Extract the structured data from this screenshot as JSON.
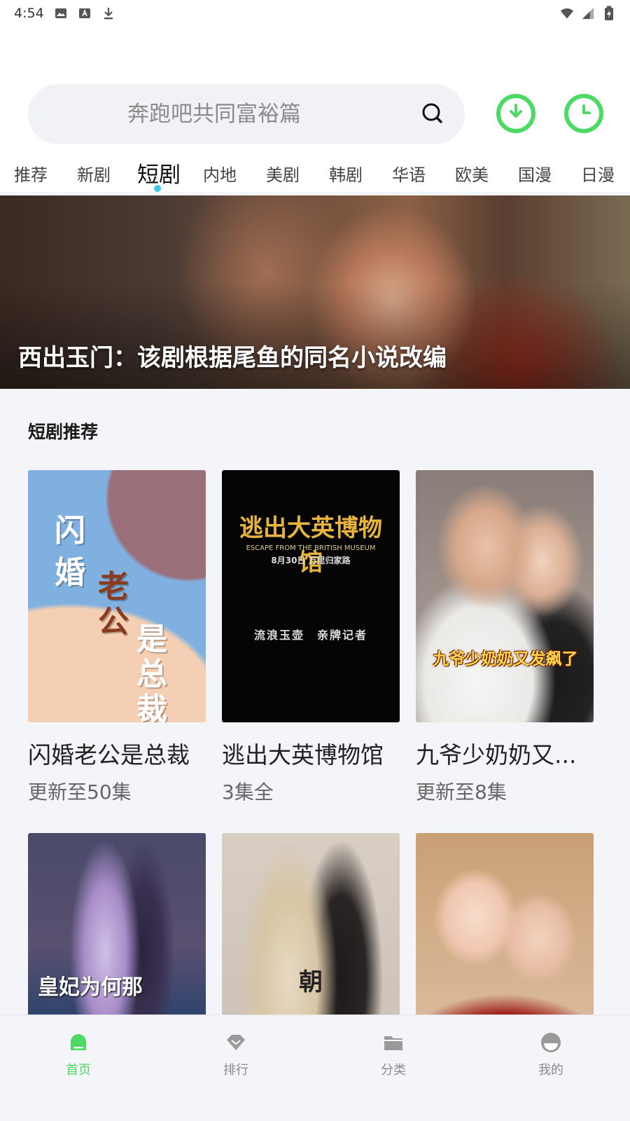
{
  "status_bar": {
    "time": "4:54"
  },
  "search": {
    "placeholder": "奔跑吧共同富裕篇"
  },
  "tabs": [
    {
      "label": "推荐"
    },
    {
      "label": "新剧"
    },
    {
      "label": "短剧",
      "active": true
    },
    {
      "label": "内地"
    },
    {
      "label": "美剧"
    },
    {
      "label": "韩剧"
    },
    {
      "label": "华语"
    },
    {
      "label": "欧美"
    },
    {
      "label": "国漫"
    },
    {
      "label": "日漫"
    }
  ],
  "banner": {
    "title": "西出玉门：该剧根据尾鱼的同名小说改编"
  },
  "section": {
    "title": "短剧推荐"
  },
  "cards": [
    {
      "name": "闪婚老公是总裁",
      "episodes": "更新至50集",
      "poster_text": {
        "l1": "闪",
        "l2": "婚",
        "l3": "老",
        "l4": "公",
        "l5": "是",
        "l6": "总",
        "l7": "裁"
      }
    },
    {
      "name": "逃出大英博物馆",
      "episodes": "3集全",
      "poster_text": {
        "title": "逃出大英博物馆",
        "sub": "ESCAPE FROM THE BRITISH MUSEUM",
        "date": "8月30日 万里归家路",
        "credits": "流浪玉壶　亲牌记者"
      }
    },
    {
      "name": "九爷少奶奶又...",
      "episodes": "更新至8集",
      "poster_text": {
        "title": "九爷少奶奶又发飙了"
      }
    },
    {
      "name": "",
      "episodes": "",
      "poster_text": {
        "title": "皇妃为何那"
      }
    },
    {
      "name": "",
      "episodes": "",
      "poster_text": {
        "title": "朝"
      }
    },
    {
      "name": "",
      "episodes": "",
      "poster_text": {
        "title": ""
      }
    }
  ],
  "bottom_nav": [
    {
      "label": "首页",
      "icon": "home-icon",
      "active": true
    },
    {
      "label": "排行",
      "icon": "ranking-icon"
    },
    {
      "label": "分类",
      "icon": "folder-icon"
    },
    {
      "label": "我的",
      "icon": "profile-icon"
    }
  ],
  "colors": {
    "accent": "#4cd964",
    "tab_indicator": "#3ec7e8"
  }
}
